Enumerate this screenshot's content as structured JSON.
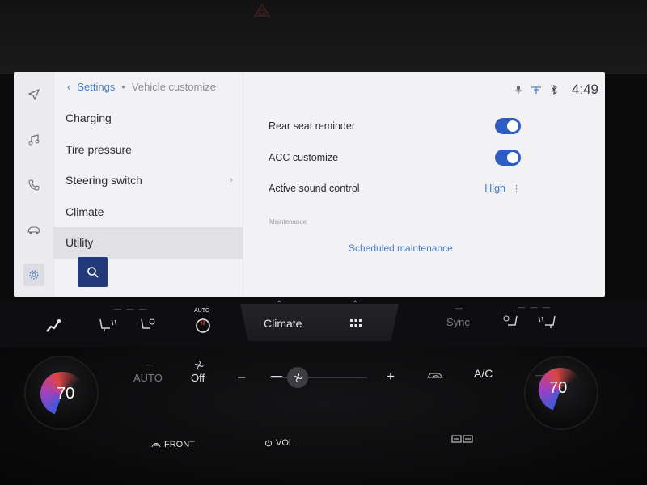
{
  "breadcrumb": {
    "back": "‹",
    "parent": "Settings",
    "separator": "•",
    "current": "Vehicle customize"
  },
  "status": {
    "time": "4:49",
    "icons": [
      "mic-icon",
      "connectivity-icon",
      "bluetooth-icon"
    ]
  },
  "rail": [
    "navigation-icon",
    "music-icon",
    "phone-icon",
    "car-icon",
    "gear-icon"
  ],
  "menu": {
    "items": [
      {
        "label": "Charging"
      },
      {
        "label": "Tire pressure"
      },
      {
        "label": "Steering switch"
      },
      {
        "label": "Climate"
      },
      {
        "label": "Utility"
      }
    ],
    "active": "Utility",
    "chevron": "›"
  },
  "settings": {
    "rear_seat": {
      "label": "Rear seat reminder",
      "on": true
    },
    "acc": {
      "label": "ACC customize",
      "on": true
    },
    "sound": {
      "label": "Active sound control",
      "value": "High",
      "more": "⋮"
    },
    "section": "Maintenance",
    "scheduled": "Scheduled maintenance"
  },
  "climate": {
    "tab_label": "Climate",
    "auto_label": "AUTO",
    "sync": "Sync",
    "auto": "AUTO",
    "off": "Off",
    "minus": "–",
    "plus": "+",
    "ac": "A/C",
    "left_temp": "70",
    "right_temp": "70",
    "front": "FRONT",
    "vol": "VOL"
  },
  "colors": {
    "accent": "#2f5cc4",
    "link": "#4a7bc7",
    "screen_bg": "#f2f2f4",
    "search_bg": "#223a7a"
  }
}
